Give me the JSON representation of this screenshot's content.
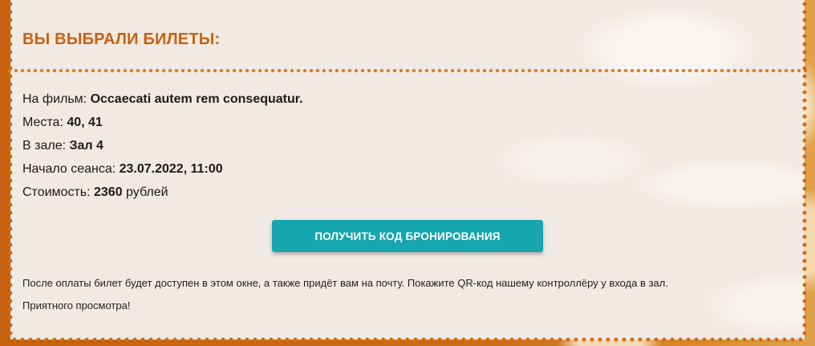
{
  "ticket": {
    "title": "ВЫ ВЫБРАЛИ БИЛЕТЫ:",
    "film_label": "На фильм: ",
    "film_value": "Occaecati autem rem consequatur.",
    "seats_label": "Места: ",
    "seats_value": "40, 41",
    "hall_label": "В зале: ",
    "hall_value": "Зал 4",
    "start_label": "Начало сеанса: ",
    "start_value": "23.07.2022, 11:00",
    "cost_label": "Стоимость: ",
    "cost_value": "2360",
    "cost_unit": " рублей",
    "button_label": "ПОЛУЧИТЬ КОД БРОНИРОВАНИЯ",
    "hint": "После оплаты билет будет доступен в этом окне, а также придёт вам на почту. Покажите QR-код нашему контроллёру у входа в зал.",
    "farewell": "Приятного просмотра!"
  },
  "colors": {
    "accent": "#c7620e",
    "button": "#16a6af",
    "ticket_bg": "#f1e9e3"
  }
}
